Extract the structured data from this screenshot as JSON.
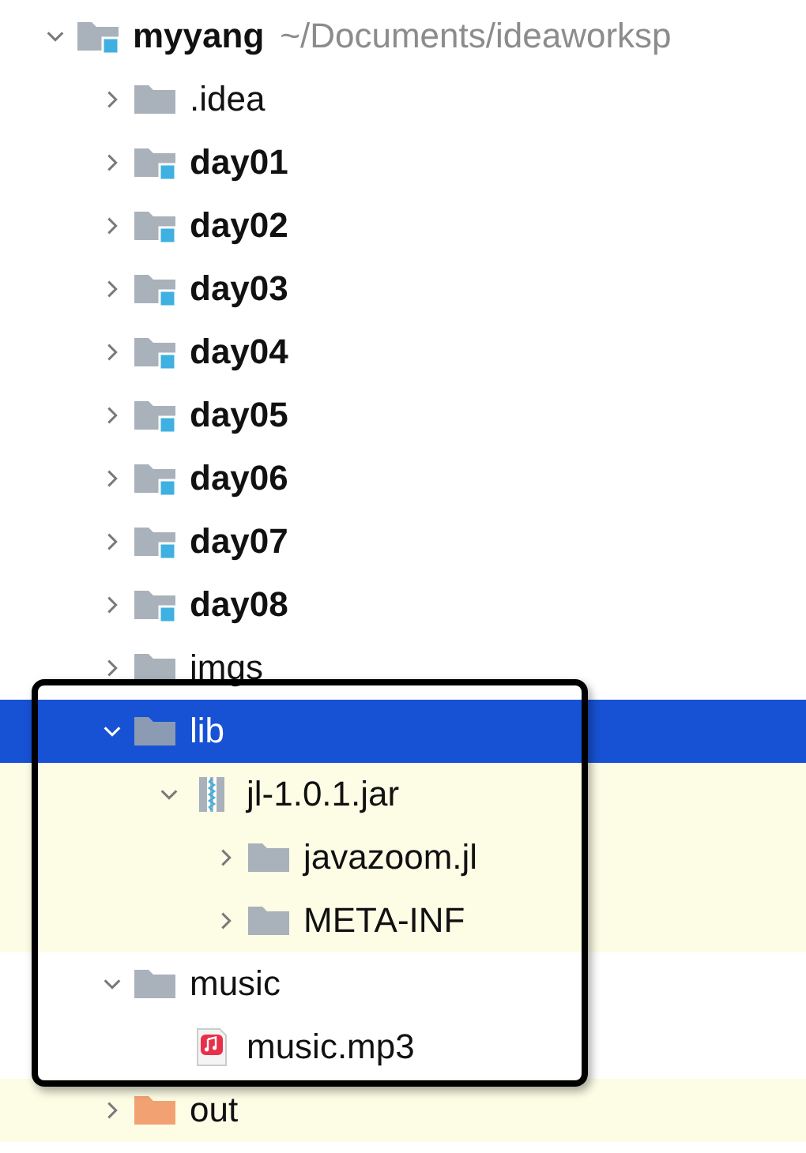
{
  "tree": [
    {
      "name": "myyang",
      "kind": "module",
      "path_hint": "~/Documents/ideaworksp",
      "expanded": true,
      "selected": false,
      "tinted": false,
      "children": [
        {
          "name": ".idea",
          "kind": "folder",
          "expanded": false,
          "selected": false,
          "tinted": false
        },
        {
          "name": "day01",
          "kind": "module",
          "expanded": false,
          "selected": false,
          "tinted": false
        },
        {
          "name": "day02",
          "kind": "module",
          "expanded": false,
          "selected": false,
          "tinted": false
        },
        {
          "name": "day03",
          "kind": "module",
          "expanded": false,
          "selected": false,
          "tinted": false
        },
        {
          "name": "day04",
          "kind": "module",
          "expanded": false,
          "selected": false,
          "tinted": false
        },
        {
          "name": "day05",
          "kind": "module",
          "expanded": false,
          "selected": false,
          "tinted": false
        },
        {
          "name": "day06",
          "kind": "module",
          "expanded": false,
          "selected": false,
          "tinted": false
        },
        {
          "name": "day07",
          "kind": "module",
          "expanded": false,
          "selected": false,
          "tinted": false
        },
        {
          "name": "day08",
          "kind": "module",
          "expanded": false,
          "selected": false,
          "tinted": false
        },
        {
          "name": "imgs",
          "kind": "folder",
          "expanded": false,
          "selected": false,
          "tinted": false
        },
        {
          "name": "lib",
          "kind": "folder",
          "expanded": true,
          "selected": true,
          "tinted": false,
          "children": [
            {
              "name": "jl-1.0.1.jar",
              "kind": "jar",
              "expanded": true,
              "selected": false,
              "tinted": true,
              "children": [
                {
                  "name": "javazoom.jl",
                  "kind": "folder",
                  "expanded": false,
                  "selected": false,
                  "tinted": true
                },
                {
                  "name": "META-INF",
                  "kind": "folder",
                  "expanded": false,
                  "selected": false,
                  "tinted": true
                }
              ]
            }
          ]
        },
        {
          "name": "music",
          "kind": "folder",
          "expanded": true,
          "selected": false,
          "tinted": false,
          "children": [
            {
              "name": "music.mp3",
              "kind": "audio",
              "selected": false,
              "tinted": false
            }
          ]
        },
        {
          "name": "out",
          "kind": "excluded",
          "expanded": false,
          "selected": false,
          "tinted": true
        }
      ]
    }
  ]
}
